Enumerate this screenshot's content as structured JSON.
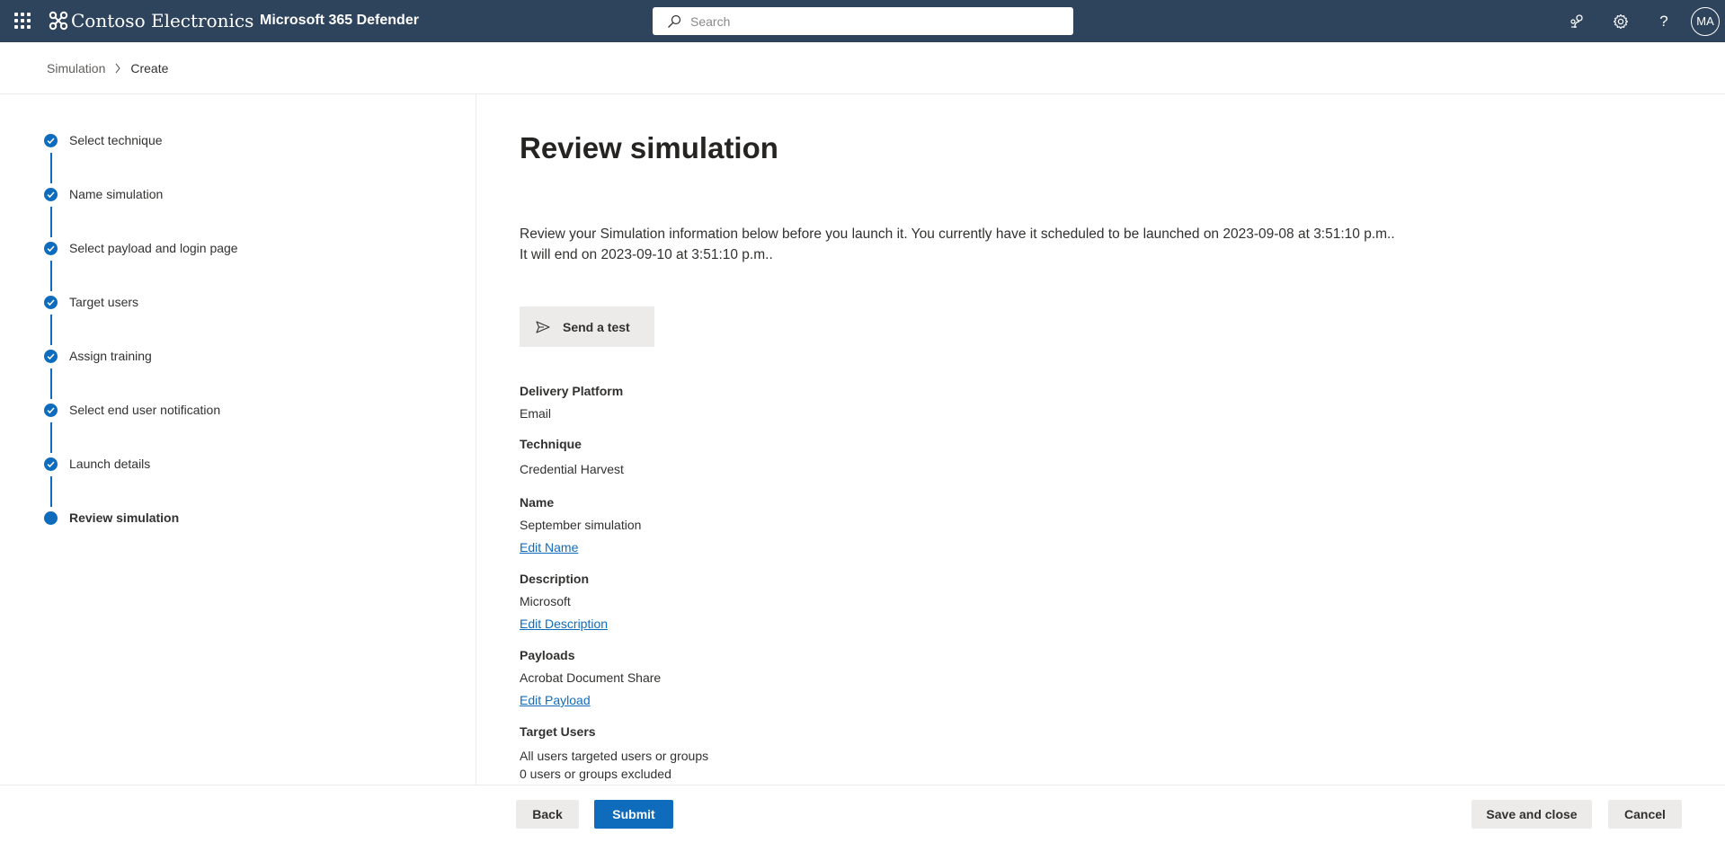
{
  "topbar": {
    "brand": "Contoso Electronics",
    "product": "Microsoft 365 Defender",
    "search_placeholder": "Search",
    "avatar_initials": "MA",
    "help_glyph": "?"
  },
  "breadcrumb": {
    "items": [
      "Simulation",
      "Create"
    ]
  },
  "steps": [
    {
      "label": "Select technique",
      "state": "completed"
    },
    {
      "label": "Name simulation",
      "state": "completed"
    },
    {
      "label": "Select payload and login page",
      "state": "completed"
    },
    {
      "label": "Target users",
      "state": "completed"
    },
    {
      "label": "Assign training",
      "state": "completed"
    },
    {
      "label": "Select end user notification",
      "state": "completed"
    },
    {
      "label": "Launch details",
      "state": "completed"
    },
    {
      "label": "Review simulation",
      "state": "current"
    }
  ],
  "main": {
    "title": "Review simulation",
    "intro": "Review your Simulation information below before you launch it. You currently have it scheduled to be launched on 2023-09-08 at 3:51:10 p.m.. It will end on 2023-09-10 at 3:51:10 p.m..",
    "send_test_label": "Send a test",
    "fields": {
      "delivery_platform": {
        "label": "Delivery Platform",
        "value": "Email"
      },
      "technique": {
        "label": "Technique",
        "value": "Credential Harvest"
      },
      "name": {
        "label": "Name",
        "value": "September simulation",
        "edit": "Edit Name"
      },
      "description": {
        "label": "Description",
        "value": "Microsoft",
        "edit": "Edit Description"
      },
      "payloads": {
        "label": "Payloads",
        "value": "Acrobat Document Share",
        "edit": "Edit Payload"
      },
      "target_users": {
        "label": "Target Users",
        "value_1": "All users targeted users or groups",
        "value_2": "0 users or groups excluded"
      }
    }
  },
  "footer": {
    "back": "Back",
    "submit": "Submit",
    "save_close": "Save and close",
    "cancel": "Cancel"
  },
  "colors": {
    "topbar": "#2e435c",
    "accent": "#0f6cbd",
    "secondary_button": "#edebe9"
  }
}
